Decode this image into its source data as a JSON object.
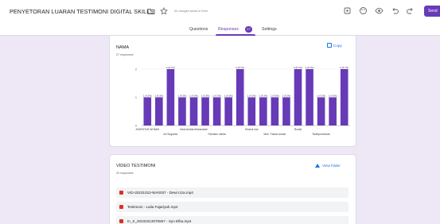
{
  "header": {
    "title": "PENYETORAN LUARAN TESTIMONI DIGITAL SKILLS",
    "saved_status": "All changes saved in Drive",
    "send_label": "Send"
  },
  "tabs": [
    {
      "label": "Questions",
      "active": false
    },
    {
      "label": "Responses",
      "active": true,
      "badge": "27"
    },
    {
      "label": "Settings",
      "active": false
    }
  ],
  "question1": {
    "title": "NAMA",
    "responses": "27 responses",
    "copy_label": "Copy"
  },
  "question2": {
    "title": "VIDEO TESTIMONI",
    "responses": "29 responses",
    "view_folder_label": "View folder",
    "files": [
      "VID-20231022-WA0037 - Dewi Izza.mp4",
      "Testimoni - Laila Fajariyah.mp4",
      "In_S_20231013075557 - Syn Efka.mp4"
    ]
  },
  "chart_data": {
    "type": "bar",
    "ylim": [
      0,
      2
    ],
    "yticks": [
      "0",
      "1",
      "2"
    ],
    "x_labels": [
      "AKHFATUN NI'MAH",
      "Ari Sugianto",
      "Dewi Andita Mubarokah",
      "Faizatun nikida",
      "Khairul nas",
      "Muh. Fawaz anwar",
      "Rosidi",
      "Taufiqurrahman"
    ],
    "values": [
      1,
      1,
      2,
      1,
      1,
      1,
      1,
      1,
      2,
      1,
      1,
      1,
      1,
      2,
      2,
      1,
      1,
      2
    ],
    "data_labels": [
      "1 (4.3%)",
      "1 (4.3%)",
      "2 (8.7%)",
      "1 (4.3%)",
      "1 (4.3%)",
      "1 (4.3%)",
      "1 (4.3%)",
      "1 (4.3%)",
      "2 (8.7%)",
      "1 (4.3%)",
      "1 (4.3%)",
      "1 (4.3%)",
      "1 (4.3%)",
      "2 (8.7%)",
      "2 (8.7%)",
      "1 (4.3%)",
      "1 (4.3%)",
      "2 (8.7%)"
    ],
    "bar_color": "#673ab7"
  },
  "colors": {
    "accent": "#673ab7",
    "background": "#ede7f6",
    "link": "#1a73e8",
    "file_icon": "#d93025"
  },
  "icons": [
    "folder-icon",
    "star-icon",
    "customize-theme-icon",
    "palette-icon",
    "preview-icon",
    "undo-icon",
    "redo-icon",
    "copy-icon",
    "drive-icon",
    "video-file-icon"
  ]
}
